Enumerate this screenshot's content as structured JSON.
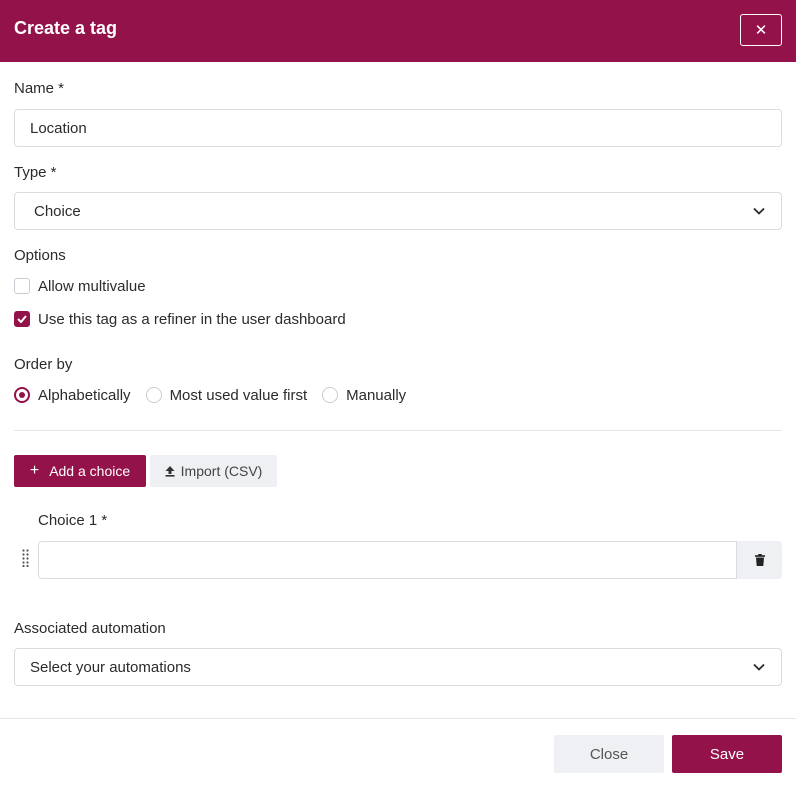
{
  "header": {
    "title": "Create a tag",
    "close_glyph": "✕"
  },
  "name_field": {
    "label": "Name *",
    "value": "Location"
  },
  "type_field": {
    "label": "Type *",
    "value": "Choice"
  },
  "options": {
    "label": "Options",
    "allow_multivalue": {
      "label": "Allow multivalue",
      "checked": false
    },
    "use_as_refiner": {
      "label": "Use this tag as a refiner in the user dashboard",
      "checked": true
    }
  },
  "order_by": {
    "label": "Order by",
    "choices": [
      {
        "label": "Alphabetically",
        "selected": true
      },
      {
        "label": "Most used value first",
        "selected": false
      },
      {
        "label": "Manually",
        "selected": false
      }
    ]
  },
  "choices_section": {
    "add_button": {
      "icon": "+",
      "label": "Add a choice"
    },
    "import_button": {
      "label": "Import (CSV)"
    },
    "choice_1": {
      "label": "Choice 1 *",
      "value": ""
    }
  },
  "automation_field": {
    "label": "Associated automation",
    "placeholder": "Select your automations"
  },
  "footer": {
    "close_label": "Close",
    "save_label": "Save"
  },
  "colors": {
    "brand": "#94124a",
    "secondary_bg": "#eef0f3",
    "border": "#d9dce1"
  }
}
